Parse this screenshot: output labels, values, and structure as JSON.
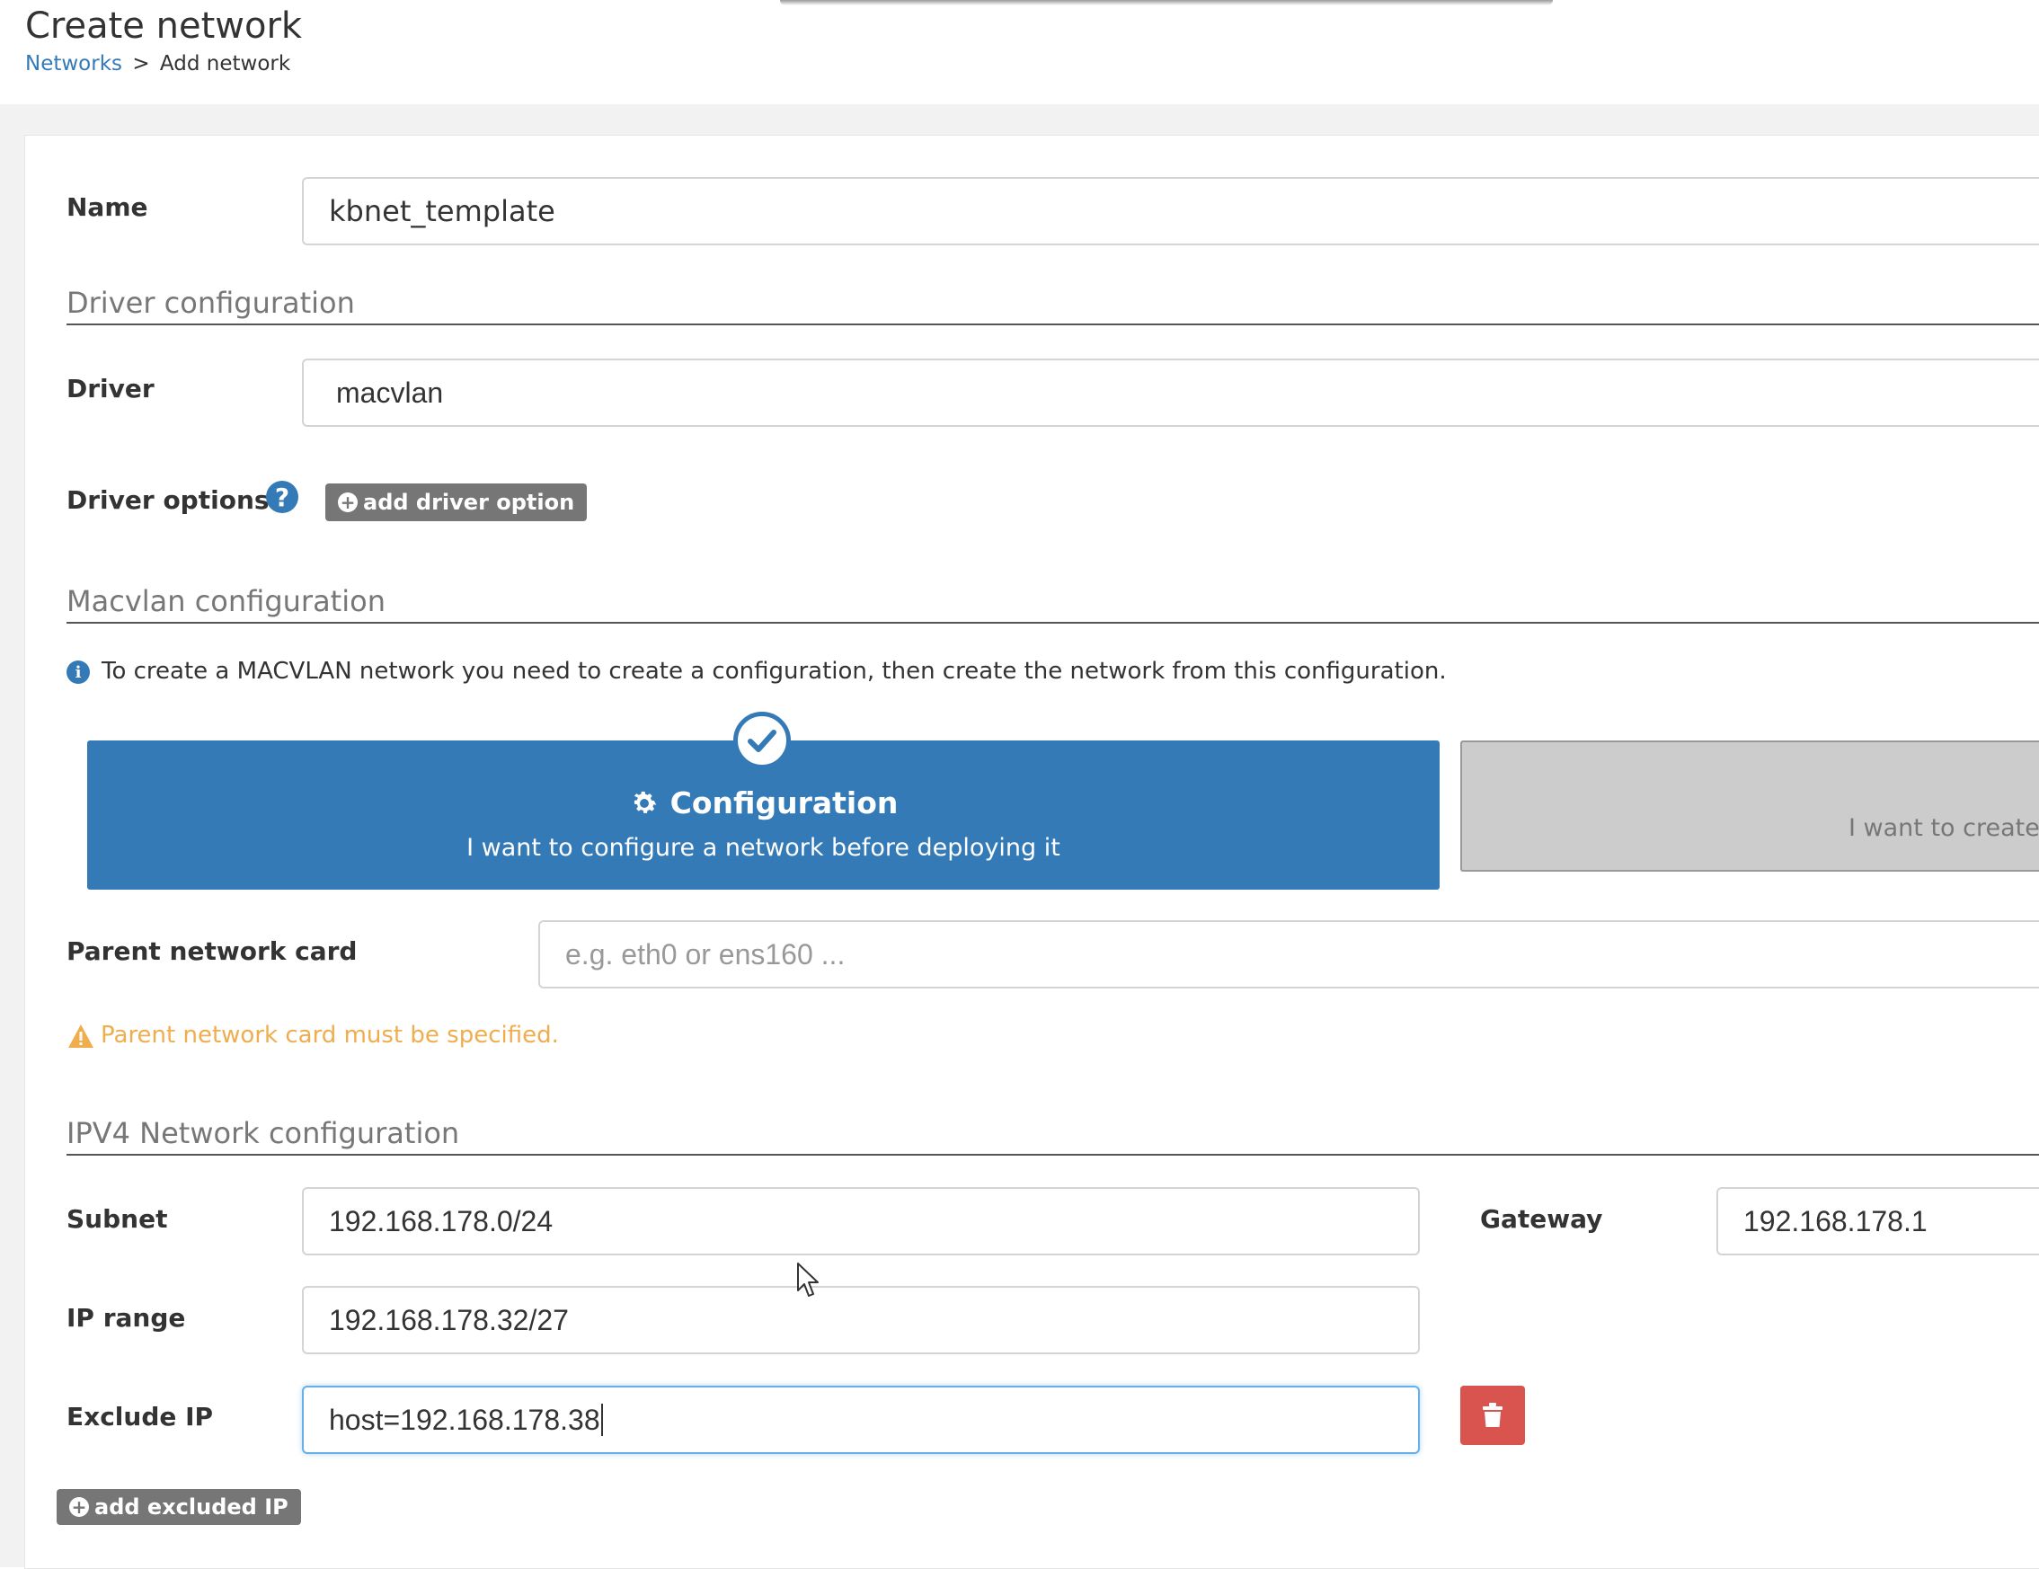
{
  "header": {
    "title": "Create network",
    "breadcrumb": {
      "link": "Networks",
      "separator": ">",
      "current": "Add network"
    }
  },
  "form": {
    "name": {
      "label": "Name",
      "value": "kbnet_template"
    },
    "driver_section": "Driver configuration",
    "driver": {
      "label": "Driver",
      "value": "macvlan"
    },
    "driver_options": {
      "label": "Driver options",
      "add_button": "add driver option"
    },
    "macvlan_section": "Macvlan configuration",
    "macvlan_info": "To create a MACVLAN network you need to create a configuration, then create the network from this configuration.",
    "macvlan_options": [
      {
        "title": "Configuration",
        "description": "I want to configure a network before deploying it",
        "selected": true,
        "icon": "gear-icon"
      },
      {
        "title": "",
        "description": "I want to create",
        "selected": false
      }
    ],
    "parent_card": {
      "label": "Parent network card",
      "placeholder": "e.g. eth0 or ens160 ...",
      "value": ""
    },
    "parent_warning": "Parent network card must be specified.",
    "ipv4_section": "IPV4 Network configuration",
    "subnet": {
      "label": "Subnet",
      "value": "192.168.178.0/24"
    },
    "gateway": {
      "label": "Gateway",
      "value": "192.168.178.1"
    },
    "ip_range": {
      "label": "IP range",
      "value": "192.168.178.32/27"
    },
    "exclude_ip": {
      "label": "Exclude IP",
      "value": "host=192.168.178.38"
    },
    "add_excluded_ip": "add excluded IP"
  },
  "colors": {
    "primary": "#337ab7",
    "selected_box": "#337ab7",
    "unselected_box": "#cccccc",
    "warning": "#f0ad4e",
    "danger": "#d9534f",
    "button_gray": "#767676"
  }
}
